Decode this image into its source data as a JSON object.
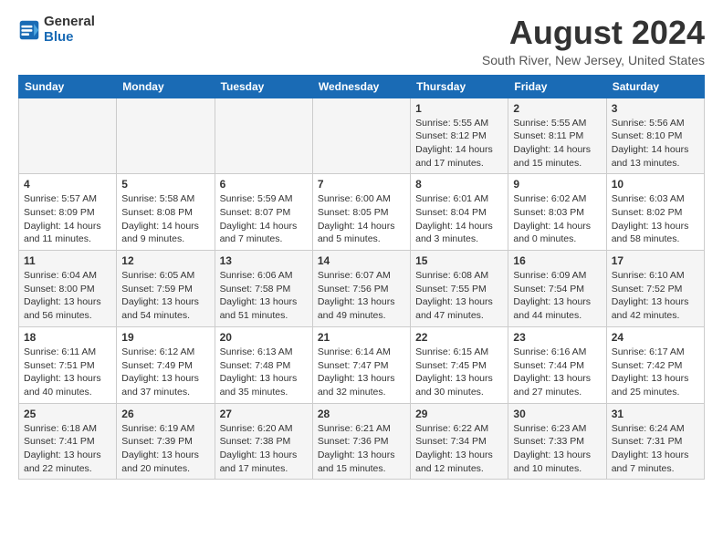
{
  "logo": {
    "general": "General",
    "blue": "Blue"
  },
  "title": "August 2024",
  "subtitle": "South River, New Jersey, United States",
  "days_header": [
    "Sunday",
    "Monday",
    "Tuesday",
    "Wednesday",
    "Thursday",
    "Friday",
    "Saturday"
  ],
  "weeks": [
    [
      {
        "day": "",
        "info": ""
      },
      {
        "day": "",
        "info": ""
      },
      {
        "day": "",
        "info": ""
      },
      {
        "day": "",
        "info": ""
      },
      {
        "day": "1",
        "info": "Sunrise: 5:55 AM\nSunset: 8:12 PM\nDaylight: 14 hours\nand 17 minutes."
      },
      {
        "day": "2",
        "info": "Sunrise: 5:55 AM\nSunset: 8:11 PM\nDaylight: 14 hours\nand 15 minutes."
      },
      {
        "day": "3",
        "info": "Sunrise: 5:56 AM\nSunset: 8:10 PM\nDaylight: 14 hours\nand 13 minutes."
      }
    ],
    [
      {
        "day": "4",
        "info": "Sunrise: 5:57 AM\nSunset: 8:09 PM\nDaylight: 14 hours\nand 11 minutes."
      },
      {
        "day": "5",
        "info": "Sunrise: 5:58 AM\nSunset: 8:08 PM\nDaylight: 14 hours\nand 9 minutes."
      },
      {
        "day": "6",
        "info": "Sunrise: 5:59 AM\nSunset: 8:07 PM\nDaylight: 14 hours\nand 7 minutes."
      },
      {
        "day": "7",
        "info": "Sunrise: 6:00 AM\nSunset: 8:05 PM\nDaylight: 14 hours\nand 5 minutes."
      },
      {
        "day": "8",
        "info": "Sunrise: 6:01 AM\nSunset: 8:04 PM\nDaylight: 14 hours\nand 3 minutes."
      },
      {
        "day": "9",
        "info": "Sunrise: 6:02 AM\nSunset: 8:03 PM\nDaylight: 14 hours\nand 0 minutes."
      },
      {
        "day": "10",
        "info": "Sunrise: 6:03 AM\nSunset: 8:02 PM\nDaylight: 13 hours\nand 58 minutes."
      }
    ],
    [
      {
        "day": "11",
        "info": "Sunrise: 6:04 AM\nSunset: 8:00 PM\nDaylight: 13 hours\nand 56 minutes."
      },
      {
        "day": "12",
        "info": "Sunrise: 6:05 AM\nSunset: 7:59 PM\nDaylight: 13 hours\nand 54 minutes."
      },
      {
        "day": "13",
        "info": "Sunrise: 6:06 AM\nSunset: 7:58 PM\nDaylight: 13 hours\nand 51 minutes."
      },
      {
        "day": "14",
        "info": "Sunrise: 6:07 AM\nSunset: 7:56 PM\nDaylight: 13 hours\nand 49 minutes."
      },
      {
        "day": "15",
        "info": "Sunrise: 6:08 AM\nSunset: 7:55 PM\nDaylight: 13 hours\nand 47 minutes."
      },
      {
        "day": "16",
        "info": "Sunrise: 6:09 AM\nSunset: 7:54 PM\nDaylight: 13 hours\nand 44 minutes."
      },
      {
        "day": "17",
        "info": "Sunrise: 6:10 AM\nSunset: 7:52 PM\nDaylight: 13 hours\nand 42 minutes."
      }
    ],
    [
      {
        "day": "18",
        "info": "Sunrise: 6:11 AM\nSunset: 7:51 PM\nDaylight: 13 hours\nand 40 minutes."
      },
      {
        "day": "19",
        "info": "Sunrise: 6:12 AM\nSunset: 7:49 PM\nDaylight: 13 hours\nand 37 minutes."
      },
      {
        "day": "20",
        "info": "Sunrise: 6:13 AM\nSunset: 7:48 PM\nDaylight: 13 hours\nand 35 minutes."
      },
      {
        "day": "21",
        "info": "Sunrise: 6:14 AM\nSunset: 7:47 PM\nDaylight: 13 hours\nand 32 minutes."
      },
      {
        "day": "22",
        "info": "Sunrise: 6:15 AM\nSunset: 7:45 PM\nDaylight: 13 hours\nand 30 minutes."
      },
      {
        "day": "23",
        "info": "Sunrise: 6:16 AM\nSunset: 7:44 PM\nDaylight: 13 hours\nand 27 minutes."
      },
      {
        "day": "24",
        "info": "Sunrise: 6:17 AM\nSunset: 7:42 PM\nDaylight: 13 hours\nand 25 minutes."
      }
    ],
    [
      {
        "day": "25",
        "info": "Sunrise: 6:18 AM\nSunset: 7:41 PM\nDaylight: 13 hours\nand 22 minutes."
      },
      {
        "day": "26",
        "info": "Sunrise: 6:19 AM\nSunset: 7:39 PM\nDaylight: 13 hours\nand 20 minutes."
      },
      {
        "day": "27",
        "info": "Sunrise: 6:20 AM\nSunset: 7:38 PM\nDaylight: 13 hours\nand 17 minutes."
      },
      {
        "day": "28",
        "info": "Sunrise: 6:21 AM\nSunset: 7:36 PM\nDaylight: 13 hours\nand 15 minutes."
      },
      {
        "day": "29",
        "info": "Sunrise: 6:22 AM\nSunset: 7:34 PM\nDaylight: 13 hours\nand 12 minutes."
      },
      {
        "day": "30",
        "info": "Sunrise: 6:23 AM\nSunset: 7:33 PM\nDaylight: 13 hours\nand 10 minutes."
      },
      {
        "day": "31",
        "info": "Sunrise: 6:24 AM\nSunset: 7:31 PM\nDaylight: 13 hours\nand 7 minutes."
      }
    ]
  ]
}
